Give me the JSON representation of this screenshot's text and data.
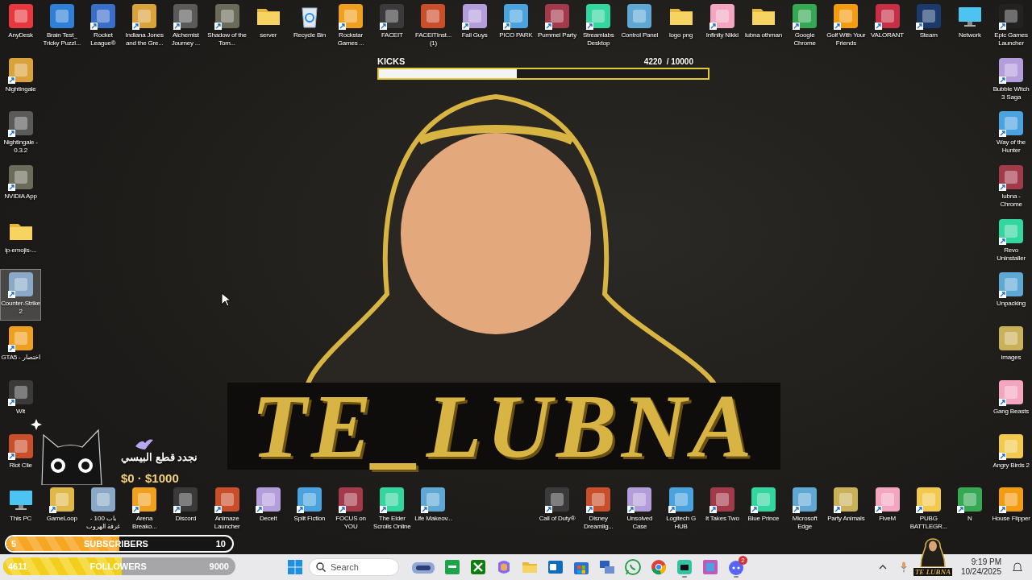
{
  "desktop": {
    "top_row": [
      {
        "label": "AnyDesk",
        "kind": "app",
        "shortcut": false,
        "selected": false
      },
      {
        "label": "Brain Test_ Tricky Puzzl...",
        "kind": "app",
        "shortcut": false,
        "selected": false
      },
      {
        "label": "Rocket League®",
        "kind": "app",
        "shortcut": true,
        "selected": false
      },
      {
        "label": "Indiana Jones and the Gre...",
        "kind": "app",
        "shortcut": true,
        "selected": false
      },
      {
        "label": "Alchemist Journey ...",
        "kind": "app",
        "shortcut": true,
        "selected": false
      },
      {
        "label": "Shadow of the Tom...",
        "kind": "app",
        "shortcut": true,
        "selected": false
      },
      {
        "label": "server",
        "kind": "folder",
        "shortcut": false,
        "selected": false
      },
      {
        "label": "Recycle Bin",
        "kind": "bin",
        "shortcut": false,
        "selected": false
      },
      {
        "label": "Rockstar Games ...",
        "kind": "app",
        "shortcut": true,
        "selected": false
      },
      {
        "label": "FACEIT",
        "kind": "app",
        "shortcut": true,
        "selected": false
      },
      {
        "label": "FACEITInst... (1)",
        "kind": "app",
        "shortcut": false,
        "selected": false
      },
      {
        "label": "Fall Guys",
        "kind": "app",
        "shortcut": true,
        "selected": false
      },
      {
        "label": "PICO PARK",
        "kind": "app",
        "shortcut": true,
        "selected": false
      },
      {
        "label": "Pummel Party",
        "kind": "app",
        "shortcut": true,
        "selected": false
      },
      {
        "label": "Streamlabs Desktop",
        "kind": "app",
        "shortcut": true,
        "selected": false
      },
      {
        "label": "Control Panel",
        "kind": "app",
        "shortcut": false,
        "selected": false
      },
      {
        "label": "logo png",
        "kind": "folder",
        "shortcut": false,
        "selected": false
      },
      {
        "label": "Infinity Nikki",
        "kind": "app",
        "shortcut": true,
        "selected": false
      },
      {
        "label": "lubna othman",
        "kind": "folder",
        "shortcut": false,
        "selected": false
      },
      {
        "label": "Google Chrome",
        "kind": "app",
        "shortcut": true,
        "selected": false
      },
      {
        "label": "Golf With Your Friends",
        "kind": "app",
        "shortcut": true,
        "selected": false
      },
      {
        "label": "VALORANT",
        "kind": "app",
        "shortcut": true,
        "selected": false
      },
      {
        "label": "Steam",
        "kind": "app",
        "shortcut": true,
        "selected": false
      },
      {
        "label": "Network",
        "kind": "pc",
        "shortcut": false,
        "selected": false
      },
      {
        "label": "Epic Games Launcher",
        "kind": "app",
        "shortcut": true,
        "selected": false
      }
    ],
    "left_column": [
      {
        "label": "Nightingale",
        "kind": "app",
        "shortcut": true,
        "selected": false
      },
      {
        "label": "Nightingale - 0.3.2",
        "kind": "app",
        "shortcut": true,
        "selected": false
      },
      {
        "label": "NVIDIA App",
        "kind": "app",
        "shortcut": true,
        "selected": false
      },
      {
        "label": "ip-emojis-...",
        "kind": "folder",
        "shortcut": false,
        "selected": false
      },
      {
        "label": "Counter-Strike 2",
        "kind": "app",
        "shortcut": true,
        "selected": true
      },
      {
        "label": "GTA5 - اختصار",
        "kind": "app",
        "shortcut": true,
        "selected": false
      },
      {
        "label": "Wit",
        "kind": "app",
        "shortcut": true,
        "selected": false
      },
      {
        "label": "Riot Clie",
        "kind": "app",
        "shortcut": true,
        "selected": false
      }
    ],
    "right_column": [
      {
        "label": "Bubble Witch 3 Saga",
        "kind": "app",
        "shortcut": true,
        "selected": false
      },
      {
        "label": "Way of the Hunter",
        "kind": "app",
        "shortcut": true,
        "selected": false
      },
      {
        "label": "lubna - Chrome",
        "kind": "app",
        "shortcut": true,
        "selected": false
      },
      {
        "label": "Revo Uninstaller",
        "kind": "app",
        "shortcut": true,
        "selected": false
      },
      {
        "label": "Unpacking",
        "kind": "app",
        "shortcut": true,
        "selected": false
      },
      {
        "label": "images",
        "kind": "app",
        "shortcut": false,
        "selected": false
      },
      {
        "label": "Gang Beasts",
        "kind": "app",
        "shortcut": true,
        "selected": false
      },
      {
        "label": "Angry Birds 2",
        "kind": "app",
        "shortcut": true,
        "selected": false
      }
    ],
    "bottom_left": [
      {
        "label": "This PC",
        "kind": "pc",
        "shortcut": false,
        "selected": false
      },
      {
        "label": "GameLoop",
        "kind": "app",
        "shortcut": true,
        "selected": false
      },
      {
        "label": "باب 100 - غرفة الهروب ...",
        "kind": "app",
        "shortcut": false,
        "selected": false
      },
      {
        "label": "Arena Breako...",
        "kind": "app",
        "shortcut": true,
        "selected": false
      },
      {
        "label": "Discord",
        "kind": "app",
        "shortcut": true,
        "selected": false
      },
      {
        "label": "Animaze Launcher",
        "kind": "app",
        "shortcut": true,
        "selected": false
      },
      {
        "label": "Deceit",
        "kind": "app",
        "shortcut": true,
        "selected": false
      },
      {
        "label": "Split Fiction",
        "kind": "app",
        "shortcut": true,
        "selected": false
      },
      {
        "label": "FOCUS on YOU",
        "kind": "app",
        "shortcut": true,
        "selected": false
      },
      {
        "label": "The Elder Scrolls Online",
        "kind": "app",
        "shortcut": true,
        "selected": false
      },
      {
        "label": "Life Makeov...",
        "kind": "app",
        "shortcut": true,
        "selected": false
      }
    ],
    "bottom_right": [
      {
        "label": "Call of Duty®",
        "kind": "app",
        "shortcut": true,
        "selected": false
      },
      {
        "label": "Disney Dreamlig...",
        "kind": "app",
        "shortcut": true,
        "selected": false
      },
      {
        "label": "Unsolved Case",
        "kind": "app",
        "shortcut": true,
        "selected": false
      },
      {
        "label": "Logitech G HUB",
        "kind": "app",
        "shortcut": true,
        "selected": false
      },
      {
        "label": "It Takes Two",
        "kind": "app",
        "shortcut": true,
        "selected": false
      },
      {
        "label": "Blue Prince",
        "kind": "app",
        "shortcut": true,
        "selected": false
      },
      {
        "label": "Microsoft Edge",
        "kind": "app",
        "shortcut": true,
        "selected": false
      },
      {
        "label": "Party Animals",
        "kind": "app",
        "shortcut": true,
        "selected": false
      },
      {
        "label": "FiveM",
        "kind": "app",
        "shortcut": true,
        "selected": false
      },
      {
        "label": "PUBG BATTLEGR...",
        "kind": "app",
        "shortcut": true,
        "selected": false
      },
      {
        "label": "N",
        "kind": "app",
        "shortcut": true,
        "selected": false
      },
      {
        "label": "House Flipper",
        "kind": "app",
        "shortcut": true,
        "selected": false
      }
    ]
  },
  "wallpaper": {
    "logo_text": "TE_LUBNA"
  },
  "kicks_goal": {
    "title": "KICKS",
    "count": "4220  / 10000",
    "level": 0.42
  },
  "donation_goal": {
    "title": "نجدد قطع البيسي",
    "amount": "$0 · $1000"
  },
  "subscribers_bar": {
    "current": "5",
    "label": "SUBSCRIBERS",
    "goal": "10",
    "level": 0.5
  },
  "followers_bar": {
    "current": "4611",
    "label": "FOLLOWERS",
    "goal": "9000",
    "level": 0.51
  },
  "streamer_overlay": {
    "text": "TE LUBNA"
  },
  "taskbar": {
    "search": {
      "placeholder": "Search"
    },
    "apps": [
      {
        "kind": "widget",
        "running": false
      },
      {
        "kind": "fam",
        "running": false
      },
      {
        "kind": "xbox",
        "running": false
      },
      {
        "kind": "copilot",
        "running": false
      },
      {
        "kind": "explorer",
        "running": false
      },
      {
        "kind": "outlook",
        "running": false
      },
      {
        "kind": "store",
        "running": false
      },
      {
        "kind": "remote",
        "running": false
      },
      {
        "kind": "whatsapp",
        "running": false
      },
      {
        "kind": "chrome",
        "running": false
      },
      {
        "kind": "streamlabs",
        "running": true
      },
      {
        "kind": "tile",
        "running": false
      },
      {
        "kind": "discord",
        "running": true,
        "badge": "2"
      }
    ],
    "clock": {
      "time": "9:19 PM",
      "date": "10/24/2025"
    }
  }
}
